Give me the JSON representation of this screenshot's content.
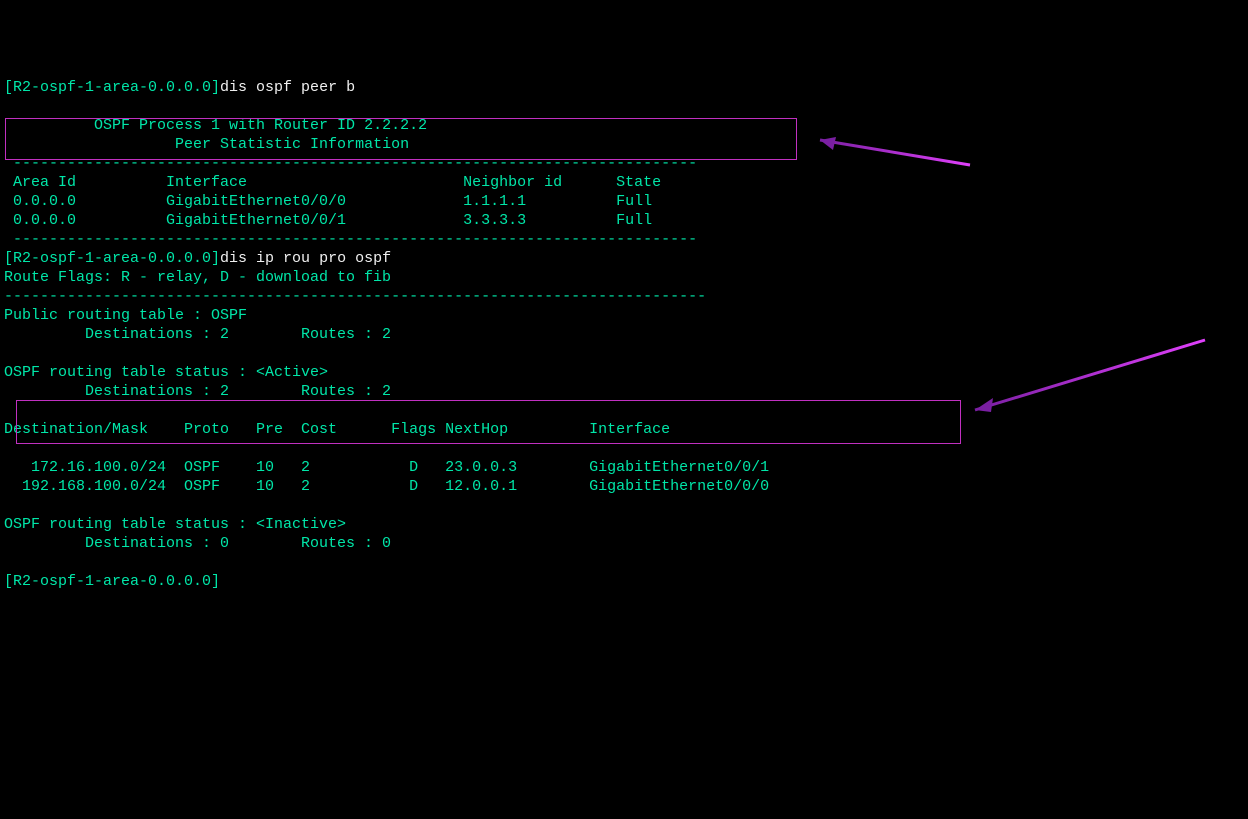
{
  "line1_prompt": "[R2-ospf-1-area-0.0.0.0]",
  "line1_cmd": "dis ospf peer b",
  "blank": "",
  "hdr1": "\t  OSPF Process 1 with Router ID 2.2.2.2",
  "hdr2": "\t\t   Peer Statistic Information",
  "dashes": " ----------------------------------------------------------------------------",
  "peer_header": " Area Id          Interface                        Neighbor id      State    ",
  "peer_row1": " 0.0.0.0          GigabitEthernet0/0/0             1.1.1.1          Full     ",
  "peer_row2": " 0.0.0.0          GigabitEthernet0/0/1             3.3.3.3          Full     ",
  "line2_prompt": "[R2-ospf-1-area-0.0.0.0]",
  "line2_cmd": "dis ip rou pro ospf",
  "routeflags": "Route Flags: R - relay, D - download to fib",
  "rdash": "------------------------------------------------------------------------------",
  "pub1": "Public routing table : OSPF",
  "pub2": "         Destinations : 2        Routes : 2",
  "act1": "OSPF routing table status : <Active>",
  "act2": "         Destinations : 2        Routes : 2",
  "rt_header": "Destination/Mask    Proto   Pre  Cost      Flags NextHop         Interface",
  "rt_row1": "   172.16.100.0/24  OSPF    10   2           D   23.0.0.3        GigabitEthernet0/0/1",
  "rt_row2": "  192.168.100.0/24  OSPF    10   2           D   12.0.0.1        GigabitEthernet0/0/0",
  "inact1": "OSPF routing table status : <Inactive>",
  "inact2": "         Destinations : 0        Routes : 0",
  "line3_prompt": "[R2-ospf-1-area-0.0.0.0]"
}
